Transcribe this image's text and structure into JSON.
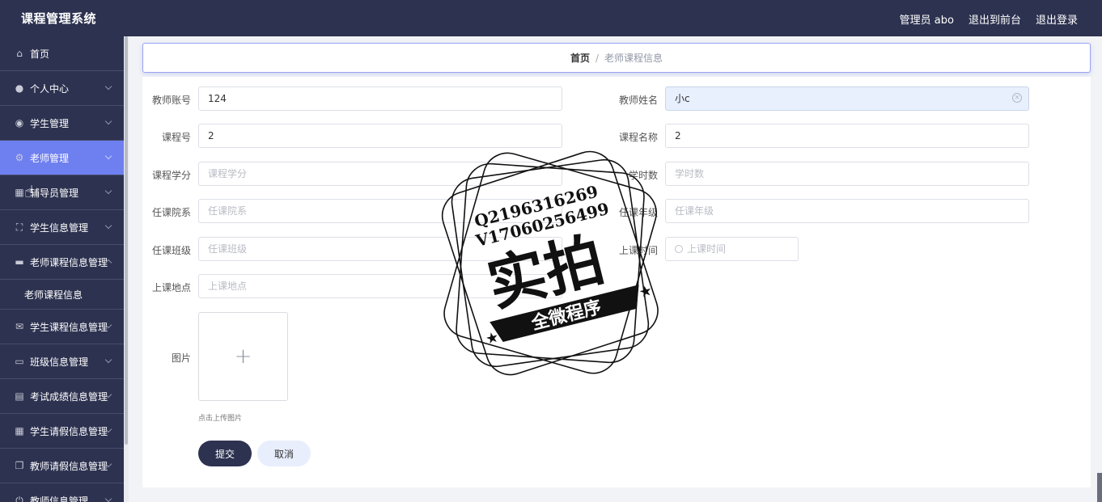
{
  "app": {
    "title": "课程管理系统",
    "user_label": "管理员 abo",
    "back_to_front": "退出到前台",
    "logout": "退出登录"
  },
  "sidebar": {
    "items": [
      {
        "label": "首页",
        "icon": "home-icon"
      },
      {
        "label": "个人中心",
        "icon": "user-icon"
      },
      {
        "label": "学生管理",
        "icon": "location-icon"
      },
      {
        "label": "老师管理",
        "icon": "setting-icon"
      },
      {
        "label": "辅导员管理",
        "icon": "grid-icon"
      },
      {
        "label": "学生信息管理",
        "icon": "fullscreen-icon"
      },
      {
        "label": "老师课程信息管理",
        "icon": "briefcase-icon"
      },
      {
        "label": "学生课程信息管理",
        "icon": "message-icon"
      },
      {
        "label": "班级信息管理",
        "icon": "monitor-icon"
      },
      {
        "label": "考试成绩信息管理",
        "icon": "document-icon"
      },
      {
        "label": "学生请假信息管理",
        "icon": "grid-icon"
      },
      {
        "label": "教师请假信息管理",
        "icon": "copy-icon"
      },
      {
        "label": "教师信息管理",
        "icon": "power-icon"
      }
    ],
    "subitems": {
      "teacher_course": "老师课程信息"
    }
  },
  "breadcrumb": {
    "home": "首页",
    "sep": "/",
    "current": "老师课程信息"
  },
  "form": {
    "teacher_account": {
      "label": "教师账号",
      "value": "124"
    },
    "teacher_name": {
      "label": "教师姓名",
      "value": "小c"
    },
    "course_no": {
      "label": "课程号",
      "value": "2"
    },
    "course_name": {
      "label": "课程名称",
      "value": "2"
    },
    "credits": {
      "label": "课程学分",
      "placeholder": "课程学分"
    },
    "hours": {
      "label": "学时数",
      "placeholder": "学时数"
    },
    "dept": {
      "label": "任课院系",
      "placeholder": "任课院系"
    },
    "grade": {
      "label": "任课年级",
      "placeholder": "任课年级"
    },
    "class": {
      "label": "任课班级",
      "placeholder": "任课班级"
    },
    "time": {
      "label": "上课时间",
      "placeholder": "上课时间"
    },
    "place": {
      "label": "上课地点",
      "placeholder": "上课地点"
    },
    "image": {
      "label": "图片",
      "tip": "点击上传图片"
    },
    "submit": "提交",
    "cancel": "取消"
  },
  "watermark": {
    "line1": "Q2196316269",
    "line2": "V17060256499",
    "main": "实拍",
    "banner": "全微程序"
  },
  "colors": {
    "header": "#2d3250",
    "active": "#6e7ff0",
    "input_focus": "#e8f0fd"
  }
}
